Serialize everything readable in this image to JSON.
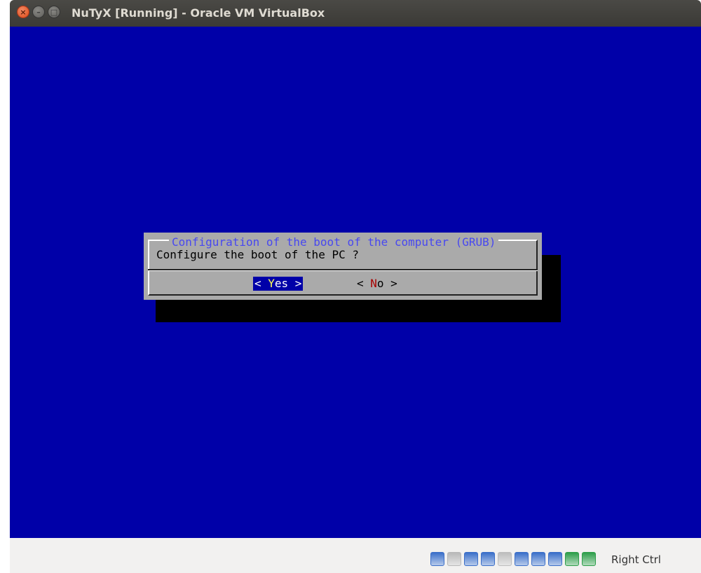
{
  "window": {
    "title": "NuTyX [Running] - Oracle VM VirtualBox",
    "close_glyph": "×",
    "min_glyph": "–",
    "max_glyph": "□"
  },
  "dialog": {
    "title": "Configuration of the boot of the computer (GRUB)",
    "prompt": "Configure the boot of the PC ?",
    "yes": {
      "left": "< ",
      "hot": "Y",
      "rest": "es",
      "right": " >"
    },
    "no": {
      "left": "< ",
      "hot": "N",
      "rest": "o",
      "right": "  >"
    }
  },
  "statusbar": {
    "host_key": "Right Ctrl",
    "icons": [
      {
        "name": "hard-disk-icon",
        "color": "#3b6fc9"
      },
      {
        "name": "optical-drive-icon",
        "color": "#b8b8b8"
      },
      {
        "name": "audio-icon",
        "color": "#3b6fc9"
      },
      {
        "name": "network-icon",
        "color": "#3b6fc9"
      },
      {
        "name": "usb-icon",
        "color": "#bdbdbd"
      },
      {
        "name": "shared-folders-icon",
        "color": "#3b6fc9"
      },
      {
        "name": "display-icon",
        "color": "#3b6fc9"
      },
      {
        "name": "video-capture-icon",
        "color": "#3b6fc9"
      },
      {
        "name": "guest-additions-icon",
        "color": "#2e9e4a"
      },
      {
        "name": "mouse-integration-icon",
        "color": "#2e9e4a"
      }
    ]
  }
}
